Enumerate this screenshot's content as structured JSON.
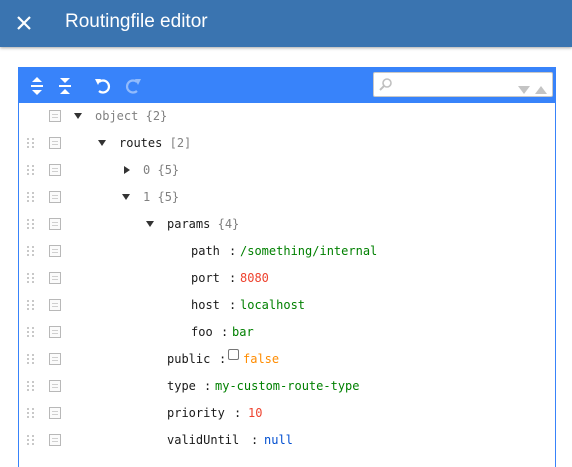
{
  "header": {
    "title": "Routingfile editor",
    "close_icon": "close-icon"
  },
  "colors": {
    "header_bg": "#3a74b0",
    "menu_bg": "#3883fa",
    "string": "#008000",
    "number": "#ee422e",
    "boolean": "#ff8c00",
    "null": "#004ed0"
  },
  "toolbar": {
    "expand_all_icon": "expand-all-icon",
    "collapse_all_icon": "collapse-all-icon",
    "undo_icon": "undo-icon",
    "redo_icon": "redo-icon",
    "search": {
      "value": "",
      "placeholder": "",
      "icon": "search-icon",
      "next_icon": "search-next-icon",
      "previous_icon": "search-previous-icon"
    }
  },
  "tree": {
    "root": {
      "field": "object",
      "count": "{2}"
    },
    "routes": {
      "field": "routes",
      "count": "[2]"
    },
    "item0": {
      "field": "0",
      "count": "{5}"
    },
    "item1": {
      "field": "1",
      "count": "{5}"
    },
    "params": {
      "field": "params",
      "count": "{4}"
    },
    "path": {
      "field": "path",
      "sep": ":",
      "value": "/something/internal"
    },
    "port": {
      "field": "port",
      "sep": ":",
      "value": "8080"
    },
    "host": {
      "field": "host",
      "sep": ":",
      "value": "localhost"
    },
    "foo": {
      "field": "foo",
      "sep": ":",
      "value": "bar"
    },
    "public": {
      "field": "public",
      "sep": ":",
      "value": "false",
      "checked": false
    },
    "type": {
      "field": "type",
      "sep": ":",
      "value": "my-custom-route-type"
    },
    "priority": {
      "field": "priority",
      "sep": ":",
      "value": "10"
    },
    "validUntil": {
      "field": "validUntil",
      "sep": ":",
      "value": "null"
    }
  }
}
